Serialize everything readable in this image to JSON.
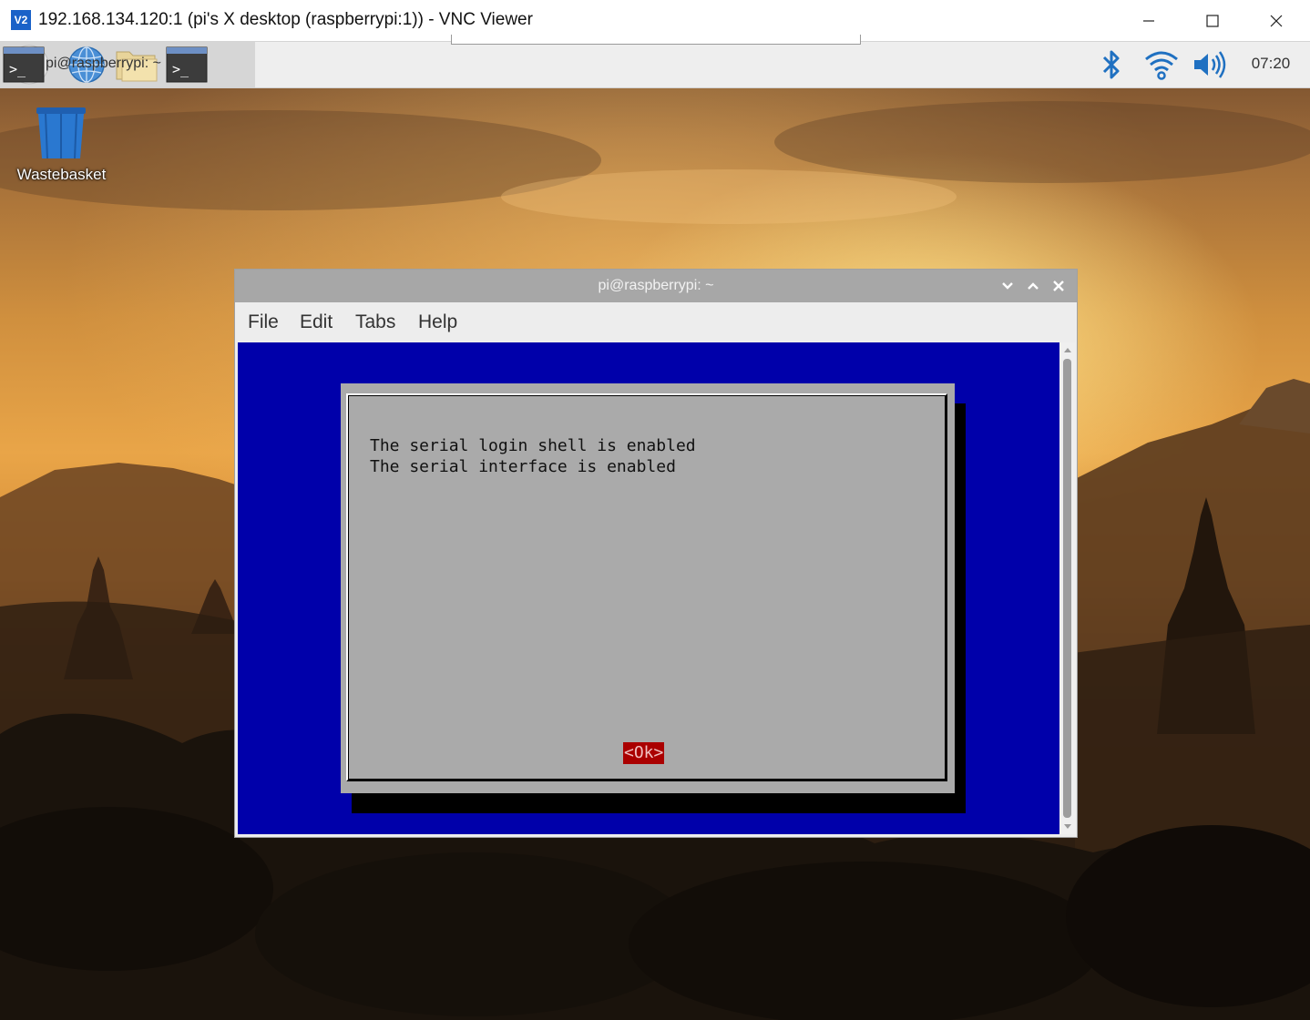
{
  "vnc_window": {
    "title": "192.168.134.120:1 (pi's X desktop (raspberrypi:1)) - VNC Viewer",
    "logo_text": "V2",
    "controls": [
      "minimize",
      "maximize",
      "close"
    ]
  },
  "panel": {
    "launchers": [
      {
        "name": "raspberry-menu",
        "icon": "raspberry-icon"
      },
      {
        "name": "web-browser",
        "icon": "globe-icon"
      },
      {
        "name": "file-manager",
        "icon": "folder-icon"
      },
      {
        "name": "terminal",
        "icon": "terminal-icon",
        "glyph": ">_"
      }
    ],
    "taskbar_item": {
      "label": "pi@raspberrypi: ~",
      "glyph": ">_"
    },
    "tray": {
      "bluetooth": "bluetooth-icon",
      "wifi": "wifi-icon",
      "volume": "volume-icon",
      "clock": "07:20"
    }
  },
  "desktop": {
    "icons": [
      {
        "label": "Wastebasket",
        "icon": "wastebasket-icon"
      }
    ]
  },
  "terminal_window": {
    "title": "pi@raspberrypi: ~",
    "menu": [
      "File",
      "Edit",
      "Tabs",
      "Help"
    ],
    "dialog": {
      "lines": [
        "The serial login shell is enabled",
        "The serial interface is enabled"
      ],
      "ok_button": "<Ok>"
    }
  },
  "colors": {
    "terminal_background": "#0000aa",
    "dialog_background": "#aaaaaa",
    "ok_button_background": "#aa0000",
    "window_titlebar": "#a7a7a7",
    "vnc_logo": "#1a62c8"
  }
}
